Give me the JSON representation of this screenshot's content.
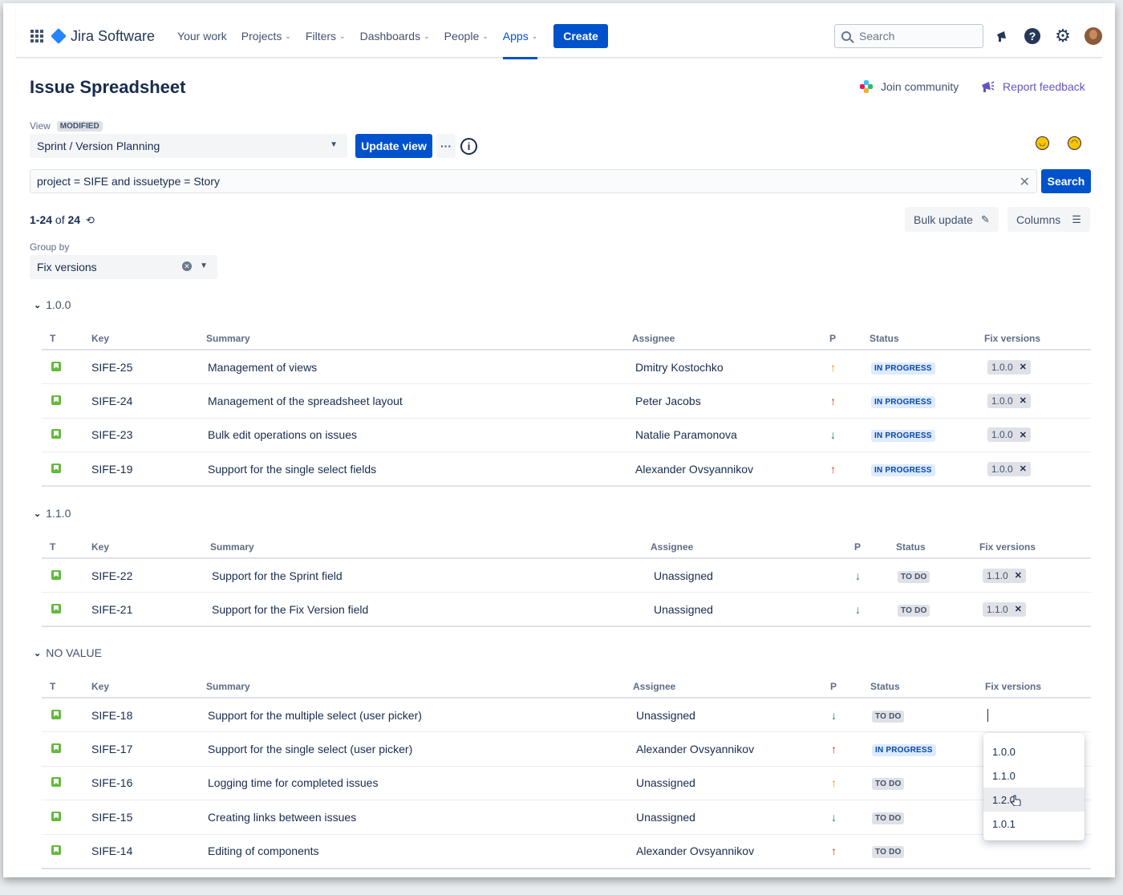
{
  "nav": {
    "product": "Jira Software",
    "items": [
      {
        "label": "Your work",
        "dropdown": false,
        "active": false
      },
      {
        "label": "Projects",
        "dropdown": true,
        "active": false
      },
      {
        "label": "Filters",
        "dropdown": true,
        "active": false
      },
      {
        "label": "Dashboards",
        "dropdown": true,
        "active": false
      },
      {
        "label": "People",
        "dropdown": true,
        "active": false
      },
      {
        "label": "Apps",
        "dropdown": true,
        "active": true
      }
    ],
    "create_label": "Create",
    "search_placeholder": "Search"
  },
  "header": {
    "title": "Issue Spreadsheet",
    "join_community": "Join community",
    "report_feedback": "Report feedback"
  },
  "view": {
    "label": "View",
    "badge": "MODIFIED",
    "selected": "Sprint / Version Planning",
    "update_label": "Update view",
    "more_label": "···"
  },
  "jql": {
    "value": "project  = SIFE and issuetype = Story",
    "search_label": "Search"
  },
  "results": {
    "range": "1-24",
    "of": "of",
    "total": "24"
  },
  "toolbar": {
    "bulk_update": "Bulk update",
    "columns": "Columns"
  },
  "group_by": {
    "label": "Group by",
    "selected": "Fix versions"
  },
  "columns": {
    "type": "T",
    "key": "Key",
    "summary": "Summary",
    "assignee": "Assignee",
    "priority": "P",
    "status": "Status",
    "fix_versions": "Fix versions"
  },
  "colors": {
    "accent": "#0052cc",
    "in_progress_bg": "#deebff",
    "in_progress_fg": "#0747a6",
    "todo_bg": "#dfe1e6",
    "todo_fg": "#42526e",
    "story": "#63ba3c"
  },
  "groups": [
    {
      "name": "1.0.0",
      "rows": [
        {
          "key": "SIFE-25",
          "summary": "Management of views",
          "assignee": "Dmitry Kostochko",
          "priority": "medium",
          "status": "IN PROGRESS",
          "fix": "1.0.0"
        },
        {
          "key": "SIFE-24",
          "summary": "Management of the spreadsheet layout",
          "assignee": "Peter Jacobs",
          "priority": "high",
          "status": "IN PROGRESS",
          "fix": "1.0.0"
        },
        {
          "key": "SIFE-23",
          "summary": "Bulk edit operations on issues",
          "assignee": "Natalie Paramonova",
          "priority": "low",
          "status": "IN PROGRESS",
          "fix": "1.0.0"
        },
        {
          "key": "SIFE-19",
          "summary": "Support for the single select fields",
          "assignee": "Alexander Ovsyannikov",
          "priority": "high",
          "status": "IN PROGRESS",
          "fix": "1.0.0"
        }
      ]
    },
    {
      "name": "1.1.0",
      "rows": [
        {
          "key": "SIFE-22",
          "summary": "Support for the Sprint field",
          "assignee": "Unassigned",
          "priority": "low",
          "status": "TO DO",
          "fix": "1.1.0"
        },
        {
          "key": "SIFE-21",
          "summary": "Support for the Fix Version field",
          "assignee": "Unassigned",
          "priority": "low",
          "status": "TO DO",
          "fix": "1.1.0"
        }
      ]
    },
    {
      "name": "NO VALUE",
      "rows": [
        {
          "key": "SIFE-18",
          "summary": "Support for the multiple select (user picker)",
          "assignee": "Unassigned",
          "priority": "low",
          "status": "TO DO",
          "fix": "",
          "editing": true
        },
        {
          "key": "SIFE-17",
          "summary": "Support for the single select (user picker)",
          "assignee": "Alexander Ovsyannikov",
          "priority": "high",
          "status": "IN PROGRESS",
          "fix": ""
        },
        {
          "key": "SIFE-16",
          "summary": "Logging time for completed issues",
          "assignee": "Unassigned",
          "priority": "medium",
          "status": "TO DO",
          "fix": ""
        },
        {
          "key": "SIFE-15",
          "summary": "Creating links between issues",
          "assignee": "Unassigned",
          "priority": "low",
          "status": "TO DO",
          "fix": ""
        },
        {
          "key": "SIFE-14",
          "summary": "Editing of components",
          "assignee": "Alexander Ovsyannikov",
          "priority": "high",
          "status": "TO DO",
          "fix": ""
        }
      ]
    }
  ],
  "fix_dropdown": {
    "options": [
      "1.0.0",
      "1.1.0",
      "1.2.0",
      "1.0.1"
    ],
    "hovered_index": 2
  },
  "icons": {
    "apps": "grid-icon",
    "notifications": "megaphone-icon",
    "help": "help-icon",
    "settings": "gear-icon",
    "refresh": "refresh-icon",
    "edit": "pencil-icon",
    "columns": "list-icon"
  }
}
